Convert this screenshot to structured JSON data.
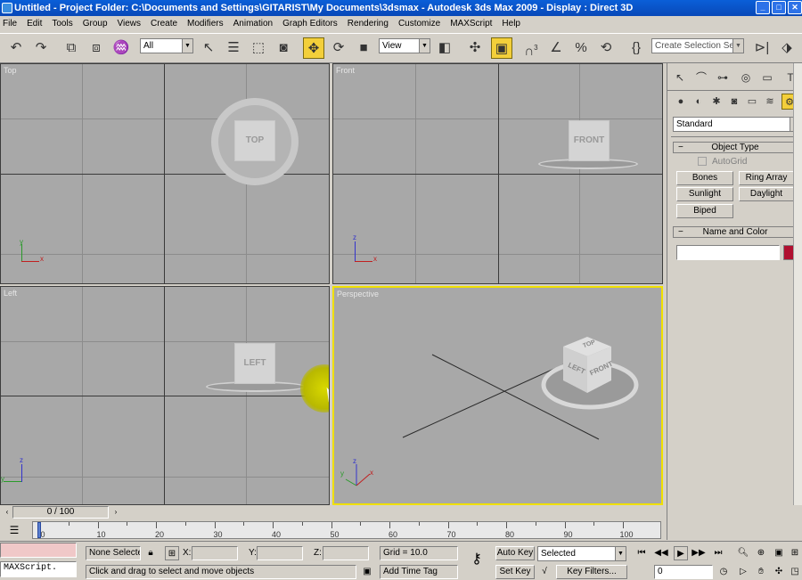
{
  "title": {
    "text": "Untitled    - Project Folder: C:\\Documents and Settings\\GITARIST\\My Documents\\3dsmax     - Autodesk 3ds Max  2009      - Display : Direct 3D",
    "buttons": [
      "_",
      "□"
    ]
  },
  "menu": [
    "File",
    "Edit",
    "Tools",
    "Group",
    "Views",
    "Create",
    "Modifiers",
    "Animation",
    "Graph Editors",
    "Rendering",
    "Customize",
    "MAXScript",
    "Help"
  ],
  "toolbar": {
    "selection_filter": "All",
    "reference_coord": "View",
    "named_selection_placeholder": "Create Selection Set",
    "snap_label": "3",
    "icons": [
      "undo-icon",
      "redo-icon",
      "select-and-link-icon",
      "unlink-icon",
      "bind-space-warp-icon",
      "select-object-icon",
      "select-by-name-icon",
      "rectangular-selection-icon",
      "window-crossing-icon",
      "select-and-move-icon",
      "select-and-rotate-icon",
      "select-and-scale-icon",
      "use-pivot-icon",
      "manipulate-icon",
      "keyboard-shortcut-icon",
      "snaps-toggle-icon",
      "angle-snap-icon",
      "percent-snap-icon",
      "spinner-snap-icon",
      "edit-named-selections-icon",
      "mirror-icon",
      "align-icon"
    ]
  },
  "viewports": {
    "top": {
      "label": "Top",
      "cube": "TOP"
    },
    "front": {
      "label": "Front",
      "cube": "FRONT"
    },
    "left": {
      "label": "Left",
      "cube": "LEFT"
    },
    "perspective": {
      "label": "Perspective",
      "cube_top": "TOP",
      "cube_left": "LEFT",
      "cube_front": "FRONT"
    },
    "axes": {
      "x": "x",
      "y": "y",
      "z": "z"
    }
  },
  "command_panel": {
    "tabs": [
      "create-tab-icon",
      "modify-tab-icon",
      "hierarchy-tab-icon",
      "motion-tab-icon",
      "display-tab-icon",
      "utilities-tab-icon"
    ],
    "categories": [
      "geometry-icon",
      "shapes-icon",
      "lights-icon",
      "cameras-icon",
      "helpers-icon",
      "space-warps-icon",
      "systems-icon"
    ],
    "dropdown": "Standard",
    "object_type": {
      "header": "Object Type",
      "autogrid": "AutoGrid",
      "buttons": [
        "Bones",
        "Ring Array",
        "Sunlight",
        "Daylight",
        "Biped"
      ]
    },
    "name_and_color": {
      "header": "Name and Color",
      "name_value": "",
      "color": "#b01030"
    }
  },
  "timeline": {
    "slider": "0 / 100",
    "ticks": [
      "0",
      "10",
      "20",
      "30",
      "40",
      "50",
      "60",
      "70",
      "80",
      "90",
      "100"
    ]
  },
  "status": {
    "maxscript": "MAXScript.",
    "selection": "None Selecte",
    "x_label": "X:",
    "y_label": "Y:",
    "z_label": "Z:",
    "grid": "Grid = 10.0",
    "prompt": "Click and drag to select and move objects",
    "add_time_tag": "Add Time Tag",
    "auto_key": "Auto Key",
    "set_key": "Set Key",
    "key_mode": "Selected",
    "key_filters": "Key Filters...",
    "frame": "0"
  }
}
